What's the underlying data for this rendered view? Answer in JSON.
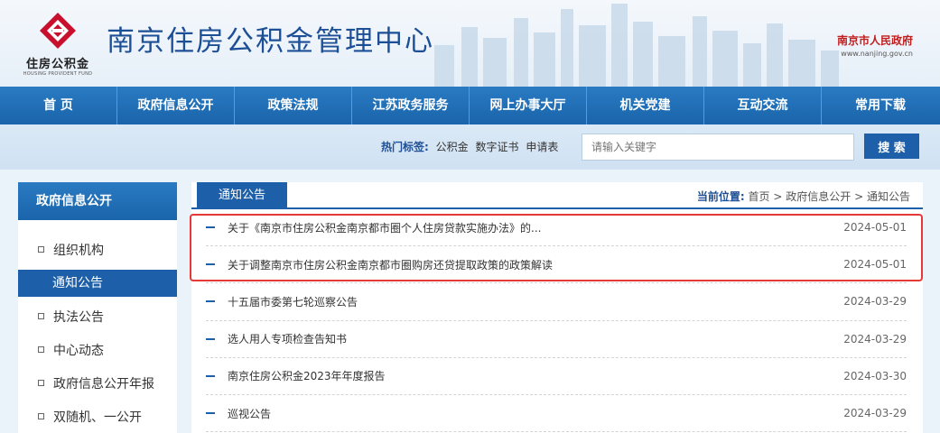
{
  "header": {
    "logo_cn": "住房公积金",
    "logo_en": "HOUSING PROVIDENT FUND",
    "site_title": "南京住房公积金管理中心",
    "gov_name": "南京市人民政府",
    "gov_url": "www.nanjing.gov.cn"
  },
  "nav": {
    "items": [
      {
        "label": "首 页"
      },
      {
        "label": "政府信息公开"
      },
      {
        "label": "政策法规"
      },
      {
        "label": "江苏政务服务"
      },
      {
        "label": "网上办事大厅"
      },
      {
        "label": "机关党建"
      },
      {
        "label": "互动交流"
      },
      {
        "label": "常用下载"
      }
    ]
  },
  "search": {
    "hot_label": "热门标签:",
    "tags": [
      "公积金",
      "数字证书",
      "申请表"
    ],
    "placeholder": "请输入关键字",
    "button_label": "搜 索"
  },
  "sidebar": {
    "title": "政府信息公开",
    "items": [
      {
        "label": "组织机构"
      },
      {
        "label": "通知公告"
      },
      {
        "label": "执法公告"
      },
      {
        "label": "中心动态"
      },
      {
        "label": "政府信息公开年报"
      },
      {
        "label": "双随机、一公开"
      }
    ]
  },
  "main": {
    "tab_label": "通知公告",
    "breadcrumb": {
      "label": "当前位置:",
      "items": [
        "首页",
        "政府信息公开",
        "通知公告"
      ],
      "separator": ">"
    },
    "news": [
      {
        "title": "关于《南京市住房公积金南京都市圈个人住房贷款实施办法》的...",
        "date": "2024-05-01"
      },
      {
        "title": "关于调整南京市住房公积金南京都市圈购房还贷提取政策的政策解读",
        "date": "2024-05-01"
      },
      {
        "title": "十五届市委第七轮巡察公告",
        "date": "2024-03-29"
      },
      {
        "title": "选人用人专项检查告知书",
        "date": "2024-03-29"
      },
      {
        "title": "南京住房公积金2023年年度报告",
        "date": "2024-03-30"
      },
      {
        "title": "巡视公告",
        "date": "2024-03-29"
      }
    ]
  },
  "colors": {
    "brand_blue": "#1d5fa8",
    "title_blue": "#1d4f96",
    "logo_red": "#c8102e",
    "highlight_red": "#e53935"
  }
}
